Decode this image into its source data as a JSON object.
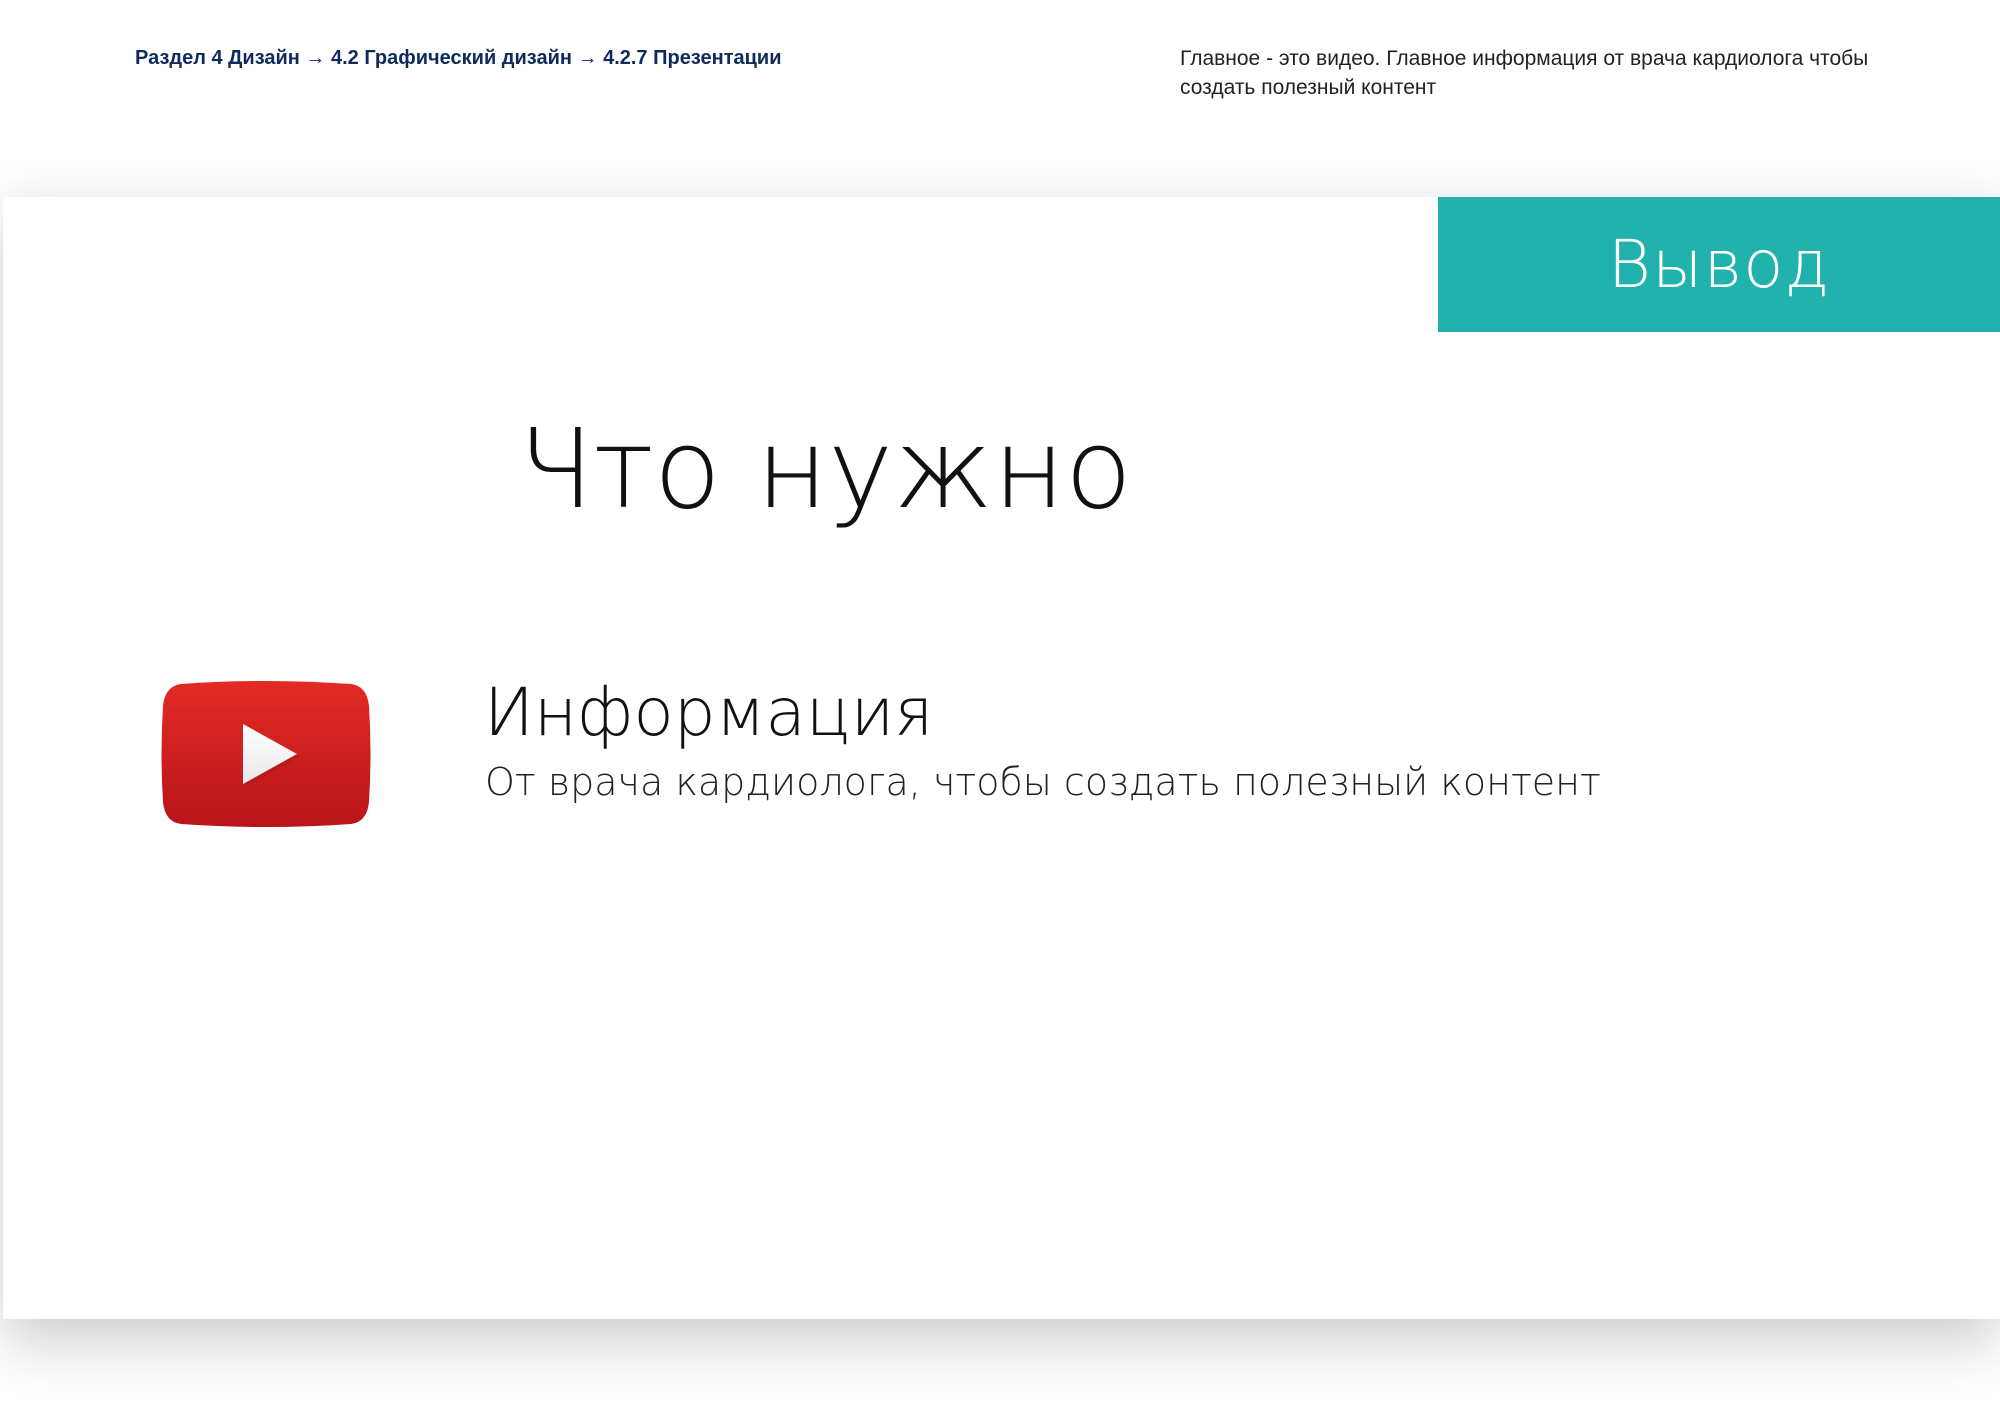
{
  "header": {
    "breadcrumb": "Раздел 4 Дизайн  → 4.2 Графический дизайн → 4.2.7 Презентации",
    "note": "Главное - это видео. Главное информация от врача кардиолога чтобы создать полезный контент"
  },
  "slide": {
    "tag": "Вывод",
    "title": "Что нужно",
    "item": {
      "icon": "youtube-logo-icon",
      "title": "Информация",
      "subtitle": "От врача кардиолога, чтобы создать полезный контент"
    }
  },
  "colors": {
    "tag_background": "#22b2ae",
    "breadcrumb_text": "#0f2a5c",
    "youtube_red": "#d42321"
  }
}
